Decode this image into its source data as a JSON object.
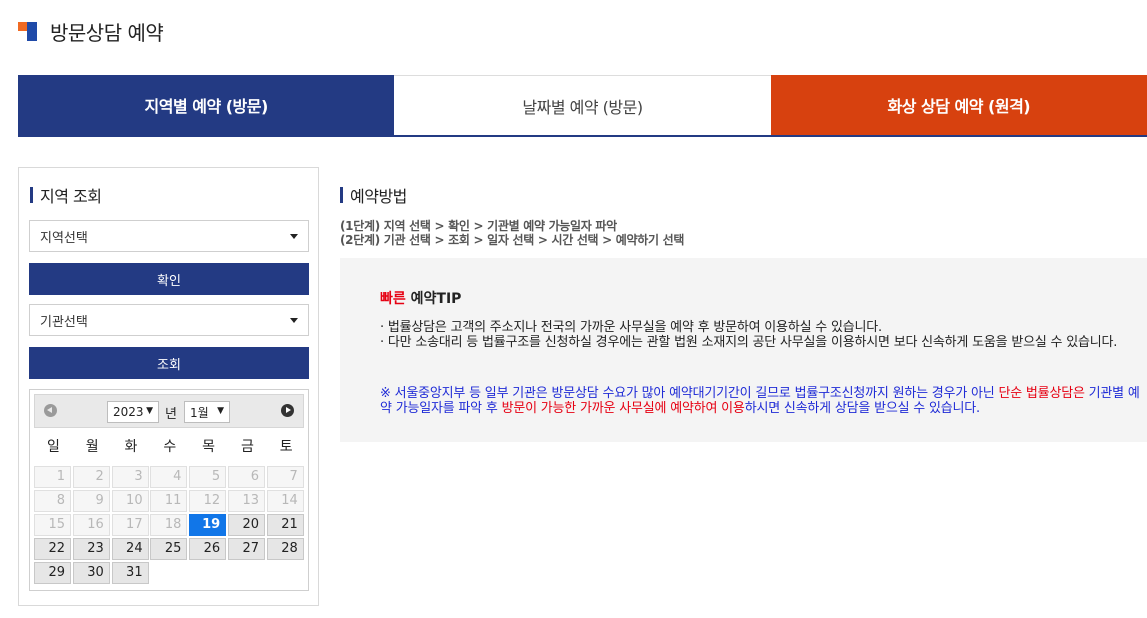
{
  "header": {
    "title": "방문상담 예약"
  },
  "tabs": [
    {
      "label": "지역별 예약 (방문)"
    },
    {
      "label": "날짜별 예약 (방문)"
    },
    {
      "label": "화상 상담 예약 (원격)"
    }
  ],
  "left_panel": {
    "title": "지역 조회",
    "region_select": "지역선택",
    "confirm_label": "확인",
    "agency_select": "기관선택",
    "search_label": "조회"
  },
  "calendar": {
    "year": "2023",
    "year_suffix": "년",
    "month": "1월",
    "weekdays": [
      "일",
      "월",
      "화",
      "수",
      "목",
      "금",
      "토"
    ],
    "today": 19,
    "days": [
      1,
      2,
      3,
      4,
      5,
      6,
      7,
      8,
      9,
      10,
      11,
      12,
      13,
      14,
      15,
      16,
      17,
      18,
      19,
      20,
      21,
      22,
      23,
      24,
      25,
      26,
      27,
      28,
      29,
      30,
      31
    ]
  },
  "reservation_method": {
    "title": "예약방법",
    "step1": "(1단계) 지역 선택 > 확인 > 기관별 예약 가능일자 파악",
    "step2": "(2단계) 기관 선택 > 조회 > 일자 선택 > 시간 선택 > 예약하기 선택"
  },
  "tip": {
    "title_highlight": "빠른",
    "title_rest": " 예약TIP",
    "line1": "· 법률상담은 고객의 주소지나 전국의 가까운 사무실을 예약 후 방문하여 이용하실 수 있습니다.",
    "line2": "· 다만 소송대리 등 법률구조를 신청하실 경우에는 관할 법원 소재지의 공단 사무실을 이용하시면 보다 신속하게 도움을 받으실 수 있습니다.",
    "note_part1": "※ 서울중앙지부 등 일부 기관은 방문상담 수요가 많아 예약대기기간이 길므로 법률구조신청까지 원하는 경우가 아닌 ",
    "note_part2": "단순 법률상담은",
    "note_part3": " 기관별 예약 가능일자를 파악 후 ",
    "note_part4": "방문이 가능한 가까운 사무실에 예약하여 이용",
    "note_part5": "하시면 신속하게 상담을 받으실 수 있습니다."
  },
  "colors": {
    "navy": "#233a83",
    "orange": "#d7410f",
    "today_blue": "#1176e8",
    "highlight_red": "#e60012",
    "note_blue": "#1f2bd6"
  }
}
